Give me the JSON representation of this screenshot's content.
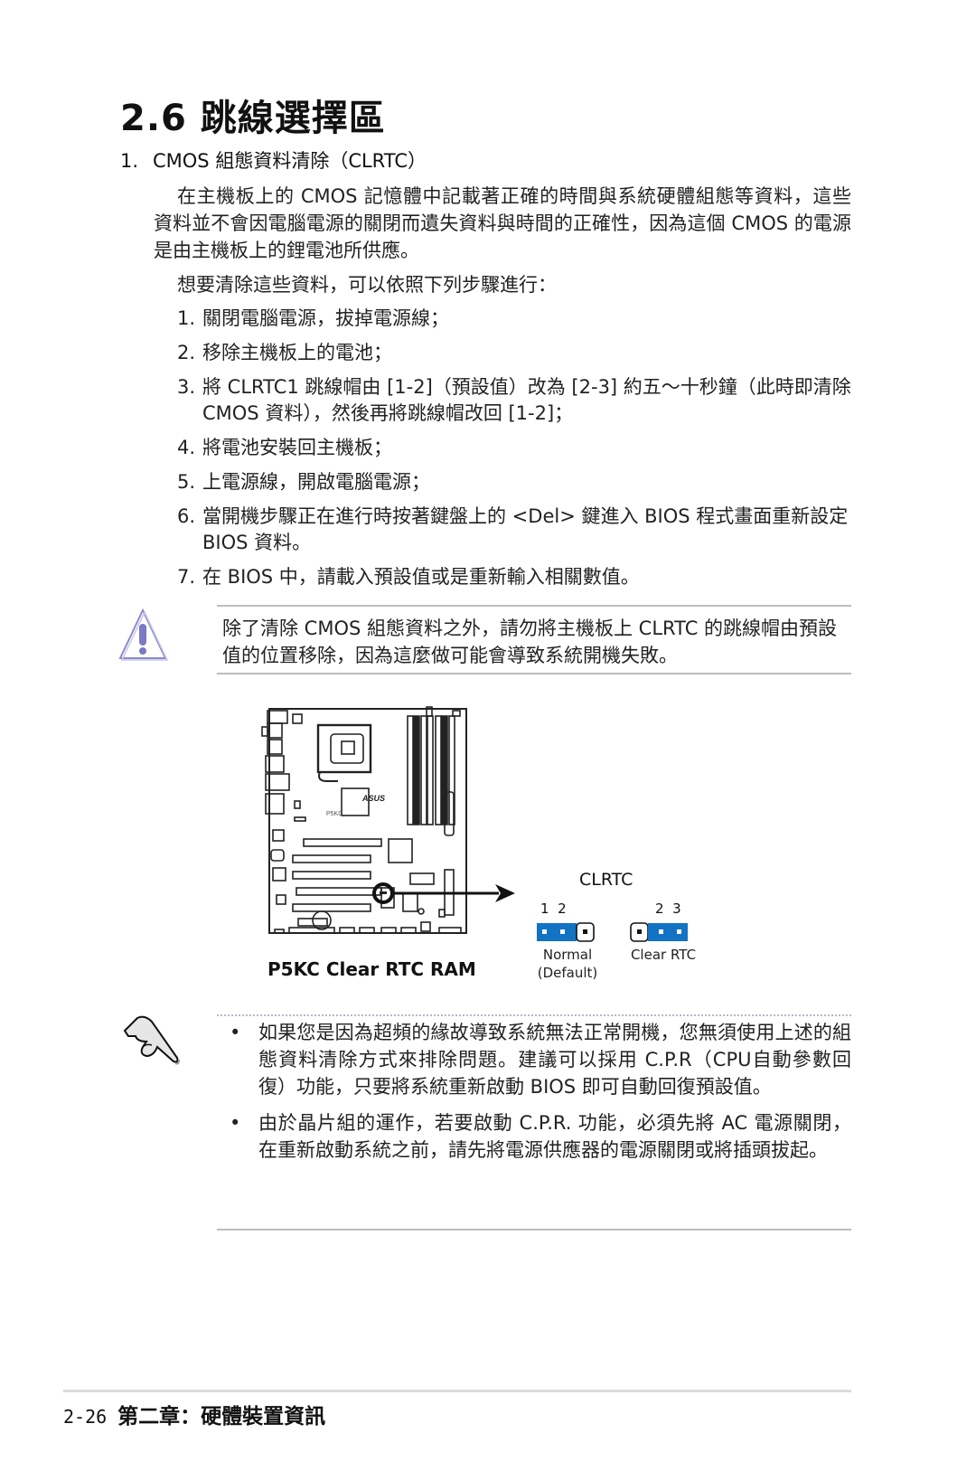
{
  "section": {
    "title": "2.6 跳線選擇區",
    "subheading_number": "1.",
    "subheading_text": "CMOS 組態資料清除（CLRTC）"
  },
  "intro": {
    "paragraph": "在主機板上的 CMOS 記憶體中記載著正確的時間與系統硬體組態等資料，這些資料並不會因電腦電源的關閉而遺失資料與時間的正確性，因為這個 CMOS 的電源是由主機板上的鋰電池所供應。",
    "steps_intro": "想要清除這些資料，可以依照下列步驟進行："
  },
  "steps": [
    {
      "num": "1.",
      "text": "關閉電腦電源，拔掉電源線；"
    },
    {
      "num": "2.",
      "text": "移除主機板上的電池；"
    },
    {
      "num": "3.",
      "text": "將 CLRTC1 跳線帽由 [1-2]（預設值）改為 [2-3] 約五～十秒鐘（此時即清除 CMOS 資料），然後再將跳線帽改回 [1-2]；"
    },
    {
      "num": "4.",
      "text": "將電池安裝回主機板；"
    },
    {
      "num": "5.",
      "text": "上電源線，開啟電腦電源；"
    },
    {
      "num": "6.",
      "text": "當開機步驟正在進行時按著鍵盤上的 <Del> 鍵進入 BIOS 程式畫面重新設定 BIOS 資料。"
    },
    {
      "num": "7.",
      "text": "在 BIOS 中，請載入預設值或是重新輸入相關數值。"
    }
  ],
  "warning": {
    "icon": "warning-triangle-icon",
    "text": "除了清除 CMOS 組態資料之外，請勿將主機板上 CLRTC 的跳線帽由預設值的位置移除，因為這麼做可能會導致系統開機失敗。"
  },
  "diagram": {
    "board_model_label": "P5KC",
    "board_brand_label": "ASUS",
    "caption": "P5KC Clear RTC RAM",
    "jumper_title": "CLRTC",
    "normal": {
      "pins": "1  2",
      "label": "Normal",
      "sublabel": "(Default)"
    },
    "clear": {
      "pins": "2  3",
      "label": "Clear RTC"
    },
    "jumper_color": "#1273c4"
  },
  "notes": {
    "icon": "pointing-hand-icon",
    "items": [
      "如果您是因為超頻的緣故導致系統無法正常開機，您無須使用上述的組態資料清除方式來排除問題。建議可以採用 C.P.R（CPU自動參數回復）功能，只要將系統重新啟動 BIOS 即可自動回復預設值。",
      "由於晶片組的運作，若要啟動 C.P.R. 功能，必須先將 AC 電源關閉，在重新啟動系統之前，請先將電源供應器的電源關閉或將插頭拔起。"
    ],
    "bullet": "•"
  },
  "footer": {
    "page_number": "2-26",
    "chapter": "第二章：硬體裝置資訊"
  }
}
